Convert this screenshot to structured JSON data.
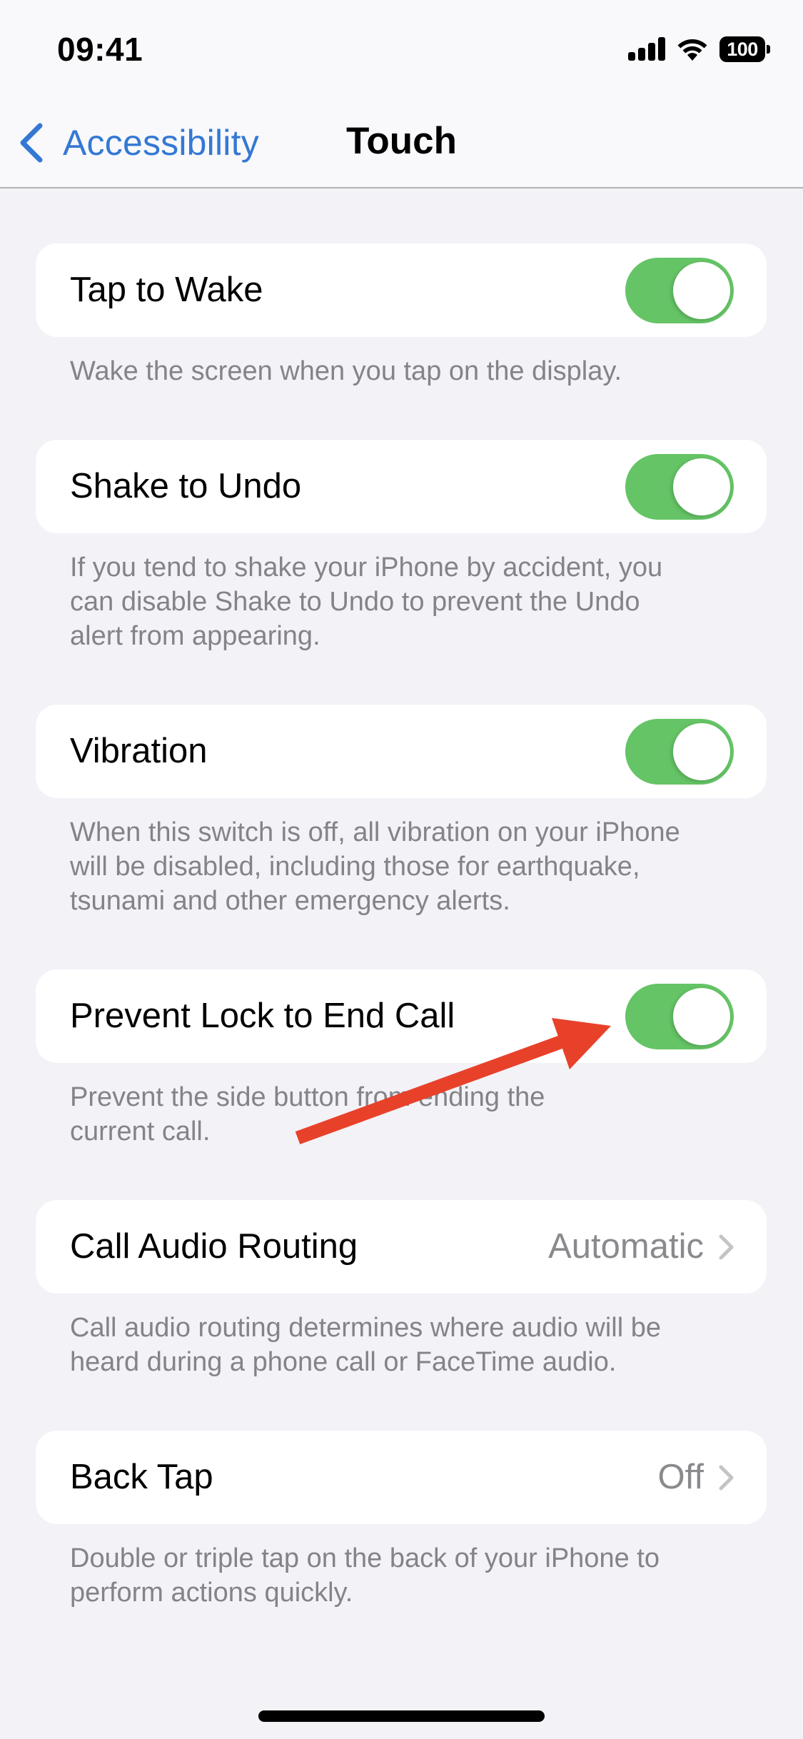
{
  "status_bar": {
    "time": "09:41",
    "battery_level": "100",
    "icons": [
      "cellular-signal-icon",
      "wifi-icon",
      "battery-icon"
    ]
  },
  "nav": {
    "back_label": "Accessibility",
    "back_icon": "chevron-left-icon",
    "title": "Touch"
  },
  "colors": {
    "accent": "#3478d4",
    "toggle_on": "#65c466",
    "background": "#f2f2f7",
    "footer_text": "#838388",
    "annotation_arrow": "#e8412a"
  },
  "settings": [
    {
      "label": "Tap to Wake",
      "type": "toggle",
      "enabled": true,
      "footer": [
        "Wake the screen when you tap on the display."
      ]
    },
    {
      "label": "Shake to Undo",
      "type": "toggle",
      "enabled": true,
      "footer": [
        "If you tend to shake your iPhone by accident, you",
        "can disable Shake to Undo to prevent the Undo",
        "alert from appearing."
      ]
    },
    {
      "label": "Vibration",
      "type": "toggle",
      "enabled": true,
      "footer": [
        "When this switch is off, all vibration on your iPhone",
        "will be disabled, including those for earthquake,",
        "tsunami and other emergency alerts."
      ]
    },
    {
      "label": "Prevent Lock to End Call",
      "type": "toggle",
      "enabled": true,
      "footer": [
        "Prevent the side button from ending the",
        "current call."
      ]
    },
    {
      "label": "Call Audio Routing",
      "type": "disclosure",
      "value": "Automatic",
      "footer": [
        "Call audio routing determines where audio will be",
        "heard during a phone call or FaceTime audio."
      ]
    },
    {
      "label": "Back Tap",
      "type": "disclosure",
      "value": "Off",
      "footer": [
        "Double or triple tap on the back of your iPhone to",
        "perform actions quickly."
      ]
    }
  ],
  "annotation": {
    "type": "arrow",
    "points_to": "Prevent Lock to End Call toggle"
  }
}
